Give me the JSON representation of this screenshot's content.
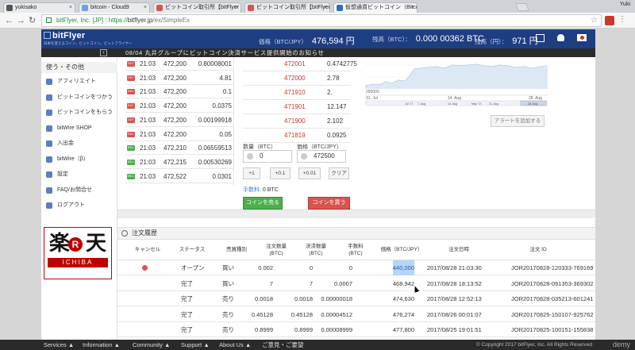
{
  "browser": {
    "tabs": [
      {
        "label": "yukisako",
        "color": "#555555"
      },
      {
        "label": "bitcoin - Cloud9",
        "color": "#6fa3d8"
      },
      {
        "label": "ビットコイン取引所【bitFlyer Lig",
        "color": "#d9534f"
      },
      {
        "label": "ビットコイン取引所【bitFlyer Lig",
        "color": "#d9534f"
      },
      {
        "label": "仮想通貨ビットコイン（Bitcoin）",
        "color": "#2f6bbf"
      }
    ],
    "user": "Yuki",
    "url": {
      "site": "bitFlyer, Inc. [JP]",
      "secure": "https://",
      "host": "bitflyer.jp",
      "path": "/ex/SimpleEx"
    }
  },
  "header": {
    "logo": "bitFlyer",
    "tagline": "日本を変えるコイン、ビットコイン。ビットフライヤー",
    "price_label": "価格（BTC/JPY）",
    "price_value": "476,594 円",
    "btc_label": "残高（BTC）：",
    "btc_value": "0.000 00362 BTC",
    "jpy_label": "残高（円）：",
    "jpy_value": "971 円"
  },
  "notice": {
    "text": "08/04 丸井グループにビットコイン決済サービス提供開始のお知らせ",
    "collapse": "‹"
  },
  "sidebar": {
    "heading": "使う・その他",
    "items": [
      {
        "label": "アフィリエイト"
      },
      {
        "label": "ビットコインをつかう"
      },
      {
        "label": "ビットコインをもらう"
      },
      {
        "label": "bitWire SHOP"
      },
      {
        "label": "入出金"
      },
      {
        "label": "bitWire（β）"
      },
      {
        "label": "設定"
      },
      {
        "label": "FAQ/お問合せ"
      },
      {
        "label": "ログアウト"
      }
    ],
    "ad": {
      "kanji1": "楽",
      "r": "R",
      "kanji2": "天",
      "ichiba": "ICHIBA"
    }
  },
  "trades": [
    {
      "side": "BUY",
      "time": "21:03",
      "price": "472,200",
      "qty": "0.80008001"
    },
    {
      "side": "BUY",
      "time": "21:03",
      "price": "472,200",
      "qty": "4.81"
    },
    {
      "side": "BUY",
      "time": "21:03",
      "price": "472,200",
      "qty": "0.1"
    },
    {
      "side": "BUY",
      "time": "21:03",
      "price": "472,200",
      "qty": "0.0375"
    },
    {
      "side": "BUY",
      "time": "21:03",
      "price": "472,200",
      "qty": "0.00199918"
    },
    {
      "side": "BUY",
      "time": "21:03",
      "price": "472,200",
      "qty": "0.05"
    },
    {
      "side": "SELL",
      "time": "21:03",
      "price": "472,210",
      "qty": "0.06559513"
    },
    {
      "side": "SELL",
      "time": "21:03",
      "price": "472,215",
      "qty": "0.00530269"
    },
    {
      "side": "SELL",
      "time": "21:03",
      "price": "472,522",
      "qty": "0.0301"
    }
  ],
  "orderbook": [
    {
      "price": "472001",
      "qty": "0.4742775",
      "grey": false
    },
    {
      "price": "472000",
      "qty": "2.78",
      "grey": false
    },
    {
      "price": "471910",
      "qty": "2.",
      "grey": false
    },
    {
      "price": "471901",
      "qty": "12.147",
      "grey": false
    },
    {
      "price": "471900",
      "qty": "2.102",
      "grey": false
    },
    {
      "price": "471819",
      "qty": "0.0925",
      "grey": false
    }
  ],
  "form": {
    "qty_label": "数量（BTC）",
    "qty_value": "0",
    "price_label": "価格（BTC/JPY）",
    "price_value": "472500",
    "q1": "+1",
    "q2": "+0.1",
    "q3": "+0.01",
    "clear": "クリア",
    "fee_label": "手数料:",
    "fee_value": "0 BTC",
    "sell": "コインを売る",
    "buy": "コインを買う"
  },
  "chart": {
    "y_tick": "250000",
    "x_ticks": [
      "31. Jul",
      "14. Aug",
      "28. Aug"
    ],
    "nav_ticks": [
      "Jul '17",
      "7. Aug",
      "14. Aug",
      "May '17",
      "21. Aug",
      "28. Aug"
    ],
    "alert": "アラートを追加する"
  },
  "history": {
    "title": "注文履歴",
    "columns": [
      "キャンセル",
      "ステータス",
      "売買種別",
      "注文数量\n(BTC)",
      "決済数量\n(BTC)",
      "手数料\n(BTC)",
      "価格（BTC/JPY）",
      "注文日時",
      "注文 ID"
    ],
    "rows": [
      {
        "cancel": true,
        "status": "オープン",
        "type": "買い",
        "qty": "0.002",
        "settled": "0",
        "fee": "0",
        "price": "440,000",
        "date": "2017/08/28 21:03:30",
        "id": "JOR20170828-120333-769169"
      },
      {
        "cancel": false,
        "status": "完了",
        "type": "買い",
        "qty": "7",
        "settled": "7",
        "fee": "0.0007",
        "price": "468,942",
        "date": "2017/08/28 18:13:52",
        "id": "JOR20170828-091353-369302"
      },
      {
        "cancel": false,
        "status": "完了",
        "type": "売り",
        "qty": "0.0018",
        "settled": "0.0018",
        "fee": "0.00000018",
        "price": "474,630",
        "date": "2017/08/28 12:52:13",
        "id": "JOR20170828-035213-601241"
      },
      {
        "cancel": false,
        "status": "完了",
        "type": "売り",
        "qty": "0.45128",
        "settled": "0.45128",
        "fee": "0.00004512",
        "price": "476,274",
        "date": "2017/08/26 00:01:07",
        "id": "JOR20170825-150107-925762"
      },
      {
        "cancel": false,
        "status": "完了",
        "type": "売り",
        "qty": "0.8999",
        "settled": "0.8999",
        "fee": "0.00008999",
        "price": "477,800",
        "date": "2017/08/25 19:01:51",
        "id": "JOR20170825-100151-155838"
      }
    ]
  },
  "footer": {
    "items": [
      "Services ▲",
      "Information ▲",
      "Community ▲",
      "Support ▲",
      "About Us ▲",
      "ご意見・ご要望"
    ],
    "copyright": "© Copyright 2017 bitFlyer, Inc. All Rights Reserved",
    "brand": "demy"
  },
  "colors": {
    "header": "#1e3e82",
    "sell": "#4cae4c",
    "buy": "#d9534f",
    "ask": "#c0392b"
  }
}
